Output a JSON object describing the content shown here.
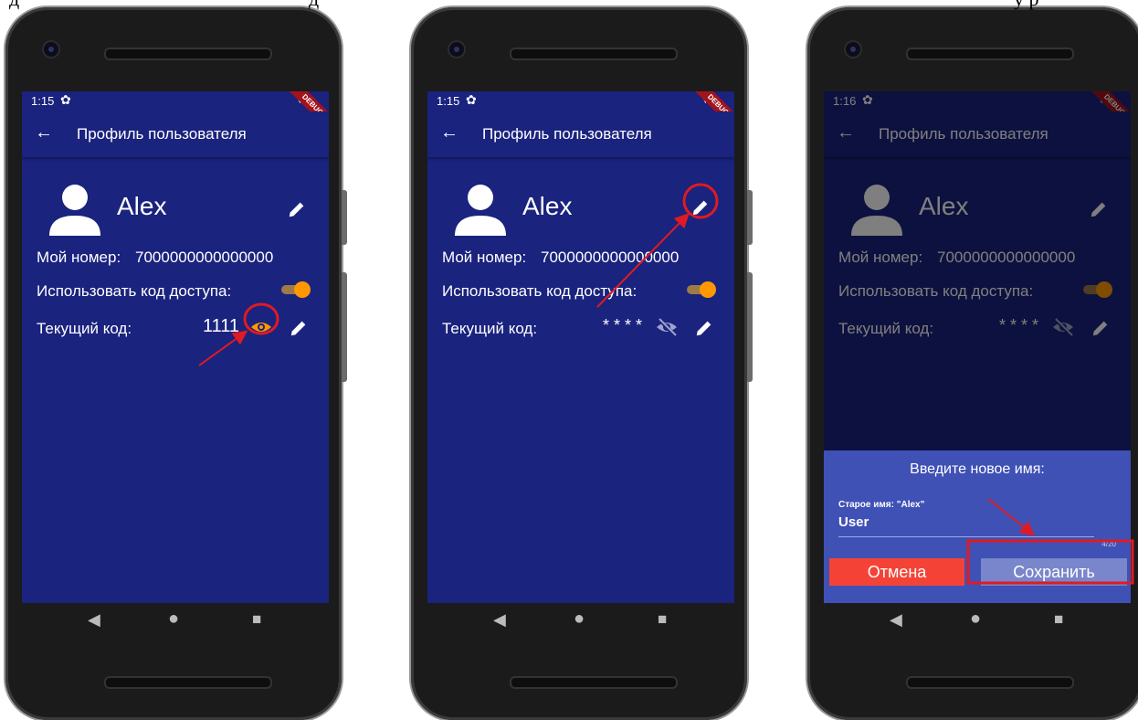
{
  "caption_fragments": {
    "left": "д",
    "mid": "д",
    "right": "у  р"
  },
  "screens": [
    {
      "status_time": "1:15",
      "debug_label": "DEBUG",
      "app_title": "Профиль пользователя",
      "user_name": "Alex",
      "phone_label": "Мой номер:",
      "phone_value": "7000000000000000",
      "access_label": "Использовать код доступа:",
      "code_label": "Текущий код:",
      "code_value": "1111"
    },
    {
      "status_time": "1:15",
      "debug_label": "DEBUG",
      "app_title": "Профиль пользователя",
      "user_name": "Alex",
      "phone_label": "Мой номер:",
      "phone_value": "7000000000000000",
      "access_label": "Использовать код доступа:",
      "code_label": "Текущий код:",
      "code_value": "* * * *"
    },
    {
      "status_time": "1:16",
      "debug_label": "DEBUG",
      "app_title": "Профиль пользователя",
      "user_name": "Alex",
      "phone_label": "Мой номер:",
      "phone_value": "7000000000000000",
      "access_label": "Использовать код доступа:",
      "code_label": "Текущий код:",
      "code_value": "* * * *",
      "dialog": {
        "heading": "Введите новое имя:",
        "field_label": "Старое имя: \"Alex\"",
        "field_value": "User",
        "counter": "4/20",
        "cancel_label": "Отмена",
        "save_label": "Сохранить"
      }
    }
  ],
  "icons": {
    "back": "arrow-left-icon",
    "settings": "gear-icon",
    "avatar": "person-icon",
    "edit": "pencil-icon",
    "show_code": "eye-icon",
    "hide_code": "eye-off-icon",
    "nav_back": "triangle-back-icon",
    "nav_home": "circle-home-icon",
    "nav_recent": "square-recent-icon"
  },
  "colors": {
    "screen_bg": "#1a237e",
    "accent_toggle": "#ff9800",
    "eye_visible": "#ff9800",
    "highlight": "#e01a22",
    "sheet_bg": "#3f51b5",
    "cancel_btn": "#f44336",
    "save_btn": "#7986cb"
  }
}
